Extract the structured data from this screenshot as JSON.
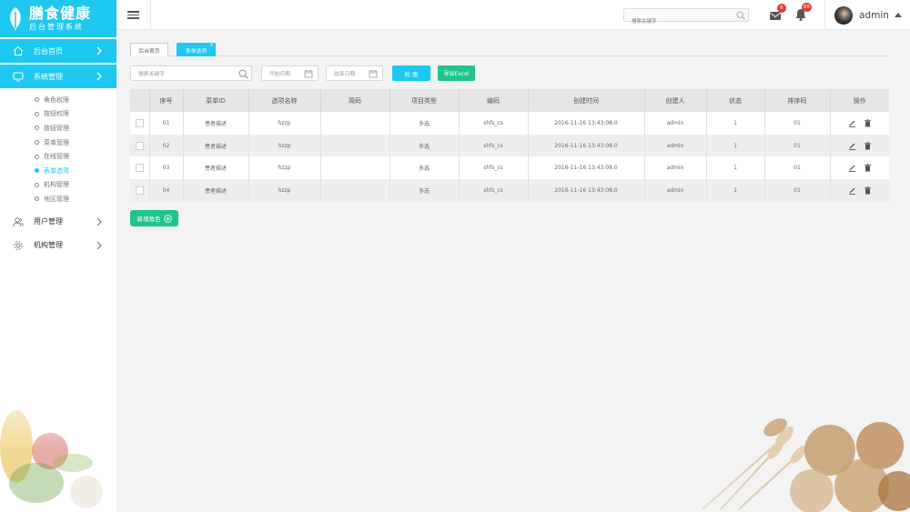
{
  "brand": {
    "title": "膳食健康",
    "subtitle": "后台管理系统",
    "color": "#1ec8f0"
  },
  "topbar": {
    "search_placeholder": "搜索关键字",
    "mail_badge": "6",
    "bell_badge": "88",
    "username": "admin"
  },
  "sidebar": {
    "items": [
      {
        "label": "后台首页",
        "icon": "home-icon",
        "active": true
      },
      {
        "label": "系统管理",
        "icon": "monitor-icon",
        "active": true,
        "children": [
          "角色权限",
          "按钮权限",
          "按钮管理",
          "菜单管理",
          "在线管理",
          "表单选项",
          "机构管理",
          "地区管理"
        ],
        "active_child": "表单选项"
      },
      {
        "label": "用户管理",
        "icon": "users-icon",
        "active": false
      },
      {
        "label": "机构管理",
        "icon": "gear-icon",
        "active": false
      }
    ]
  },
  "tabs": [
    {
      "label": "后台首页",
      "active": false
    },
    {
      "label": "表单选项",
      "active": true,
      "close": "×"
    }
  ],
  "filters": {
    "keyword_placeholder": "搜索关键字",
    "start_date_placeholder": "开始日期",
    "end_date_placeholder": "结束日期",
    "search_label": "检 索",
    "export_label": "导出Excel"
  },
  "table": {
    "headers": [
      "",
      "序号",
      "菜单ID",
      "选项名称",
      "简码",
      "项目类型",
      "编码",
      "创建时间",
      "创建人",
      "状态",
      "排序码",
      "操作"
    ],
    "rows": [
      {
        "no": "01",
        "menu": "患者描述",
        "name": "hzzp",
        "code": "",
        "type": "多选",
        "enc": "shfs_cs",
        "time": "2016-11-16 13:43:08.0",
        "creator": "admin",
        "status": "1",
        "sort": "01"
      },
      {
        "no": "02",
        "menu": "患者描述",
        "name": "hzzp",
        "code": "",
        "type": "多选",
        "enc": "shfs_cs",
        "time": "2016-11-16 13:43:08.0",
        "creator": "admin",
        "status": "1",
        "sort": "01"
      },
      {
        "no": "03",
        "menu": "患者描述",
        "name": "hzzp",
        "code": "",
        "type": "多选",
        "enc": "shfs_cs",
        "time": "2016-11-16 13:43:08.0",
        "creator": "admin",
        "status": "1",
        "sort": "01"
      },
      {
        "no": "04",
        "menu": "患者描述",
        "name": "hzzp",
        "code": "",
        "type": "多选",
        "enc": "shfs_cs",
        "time": "2016-11-16 13:43:08.0",
        "creator": "admin",
        "status": "1",
        "sort": "01"
      }
    ]
  },
  "add_button": {
    "label": "新增角色"
  },
  "colors": {
    "accent": "#1ec8f0",
    "green": "#20c48a",
    "badge": "#e53b3b"
  }
}
